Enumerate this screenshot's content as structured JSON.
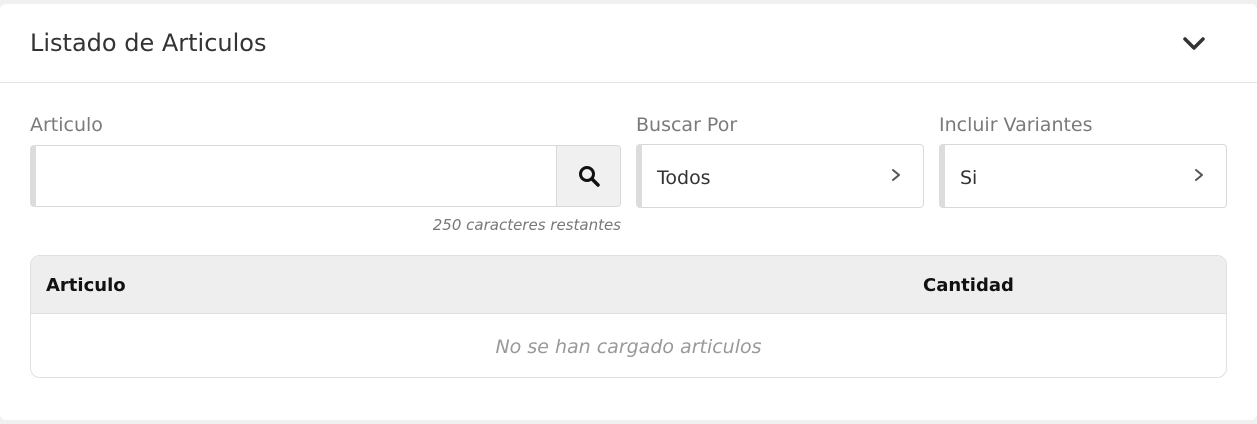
{
  "panel": {
    "title": "Listado de Articulos",
    "collapse_icon": "chevron-down-icon"
  },
  "article_field": {
    "label": "Articulo",
    "value": "",
    "placeholder": "",
    "search_icon": "search-icon",
    "char_counter": "250 caracteres restantes"
  },
  "search_by": {
    "label": "Buscar Por",
    "value": "Todos",
    "icon": "chevron-right-icon"
  },
  "include_variants": {
    "label": "Incluir Variantes",
    "value": "Si",
    "icon": "chevron-right-icon"
  },
  "table": {
    "columns": [
      "Articulo",
      "Cantidad"
    ],
    "rows": [],
    "empty_message": "No se han cargado articulos"
  }
}
